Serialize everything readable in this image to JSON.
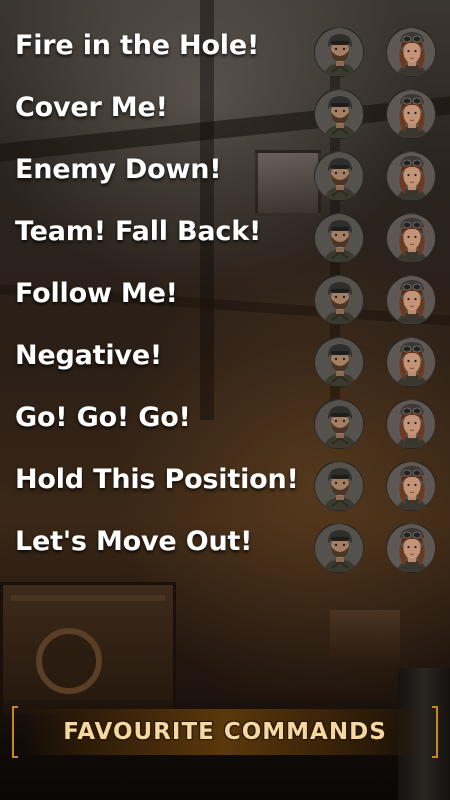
{
  "commands": [
    {
      "label": "Fire in the Hole!"
    },
    {
      "label": "Cover Me!"
    },
    {
      "label": "Enemy Down!"
    },
    {
      "label": "Team! Fall Back!"
    },
    {
      "label": "Follow Me!"
    },
    {
      "label": "Negative!"
    },
    {
      "label": "Go! Go! Go!"
    },
    {
      "label": "Hold This Position!"
    },
    {
      "label": "Let's Move Out!"
    }
  ],
  "favourite_button": {
    "label": "FAVOURITE COMMANDS"
  },
  "colors": {
    "accent": "#c9871f",
    "button_text": "#f3d8a1",
    "label_text": "#ffffff"
  },
  "icons": {
    "male_voice": "male-soldier-avatar-icon",
    "female_voice": "female-soldier-avatar-icon"
  }
}
